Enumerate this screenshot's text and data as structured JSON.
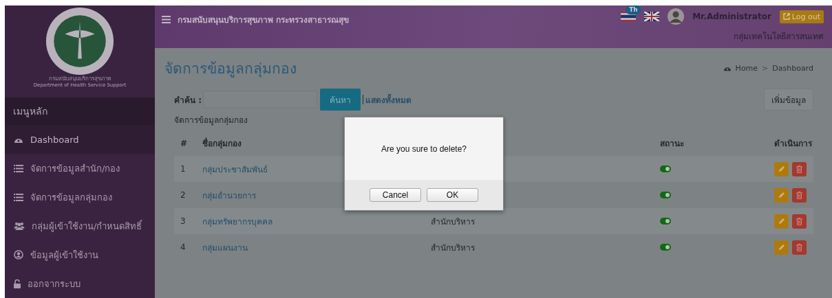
{
  "sidebar": {
    "logo_caption": "กรมสนับสนุนบริการสุขภาพ",
    "logo_subcaption": "Department of Health Service Support",
    "menu_title": "เมนูหลัก",
    "items": [
      {
        "label": "Dashboard",
        "kind": "dashboard",
        "selected": true
      },
      {
        "label": "จัดการข้อมูลสำนัก/กอง",
        "kind": "list",
        "selected": false
      },
      {
        "label": "จัดการข้อมูลกลุ่มกอง",
        "kind": "list",
        "selected": false
      },
      {
        "label": "กลุ่มผู้เข้าใช้งาน/กำหนดสิทธิ์",
        "kind": "users",
        "selected": false
      },
      {
        "label": "ข้อมูลผู้เข้าใช้งาน",
        "kind": "user",
        "selected": false
      },
      {
        "label": "ออกจากระบบ",
        "kind": "lock",
        "selected": false
      }
    ]
  },
  "header": {
    "title": "กรมสนับสนุนบริการสุขภาพ กระทรวงสาธารณสุข",
    "language_badge": "Th",
    "user_name": "Mr.Administrator",
    "logout_label": "Log out",
    "user_group": "กลุ่มเทคโนโลยีสารสนเทศ"
  },
  "page": {
    "title": "จัดการข้อมูลกลุ่มกอง",
    "breadcrumb": [
      "Home",
      "Dashboard"
    ],
    "breadcrumb_separator": ">",
    "search_label": "คำค้น :",
    "search_button": "ค้นหา",
    "show_all_link": "แสดงทั้งหมด",
    "add_button": "เพิ่มข้อมูล",
    "table_caption": "จัดการข้อมูลกลุ่มกอง",
    "table": {
      "columns": {
        "number": "#",
        "name": "ชื่อกลุ่มกอง",
        "status": "สถานะ",
        "actions": "ดำเนินการ"
      },
      "rows": [
        {
          "number": "1",
          "name": "กลุ่มประชาสัมพันธ์",
          "active": true
        },
        {
          "number": "2",
          "name": "กลุ่มอำนวยการ",
          "active": true
        },
        {
          "number": "3",
          "name": "กลุ่มทรัพยากรบุคคล",
          "office": "สำนักบริหาร",
          "active": true
        },
        {
          "number": "4",
          "name": "กลุ่มแผนงาน",
          "office": "สำนักบริหาร",
          "active": true
        }
      ]
    }
  },
  "dialog": {
    "message": "Are you sure to delete?",
    "buttons": [
      "Cancel",
      "OK"
    ]
  }
}
